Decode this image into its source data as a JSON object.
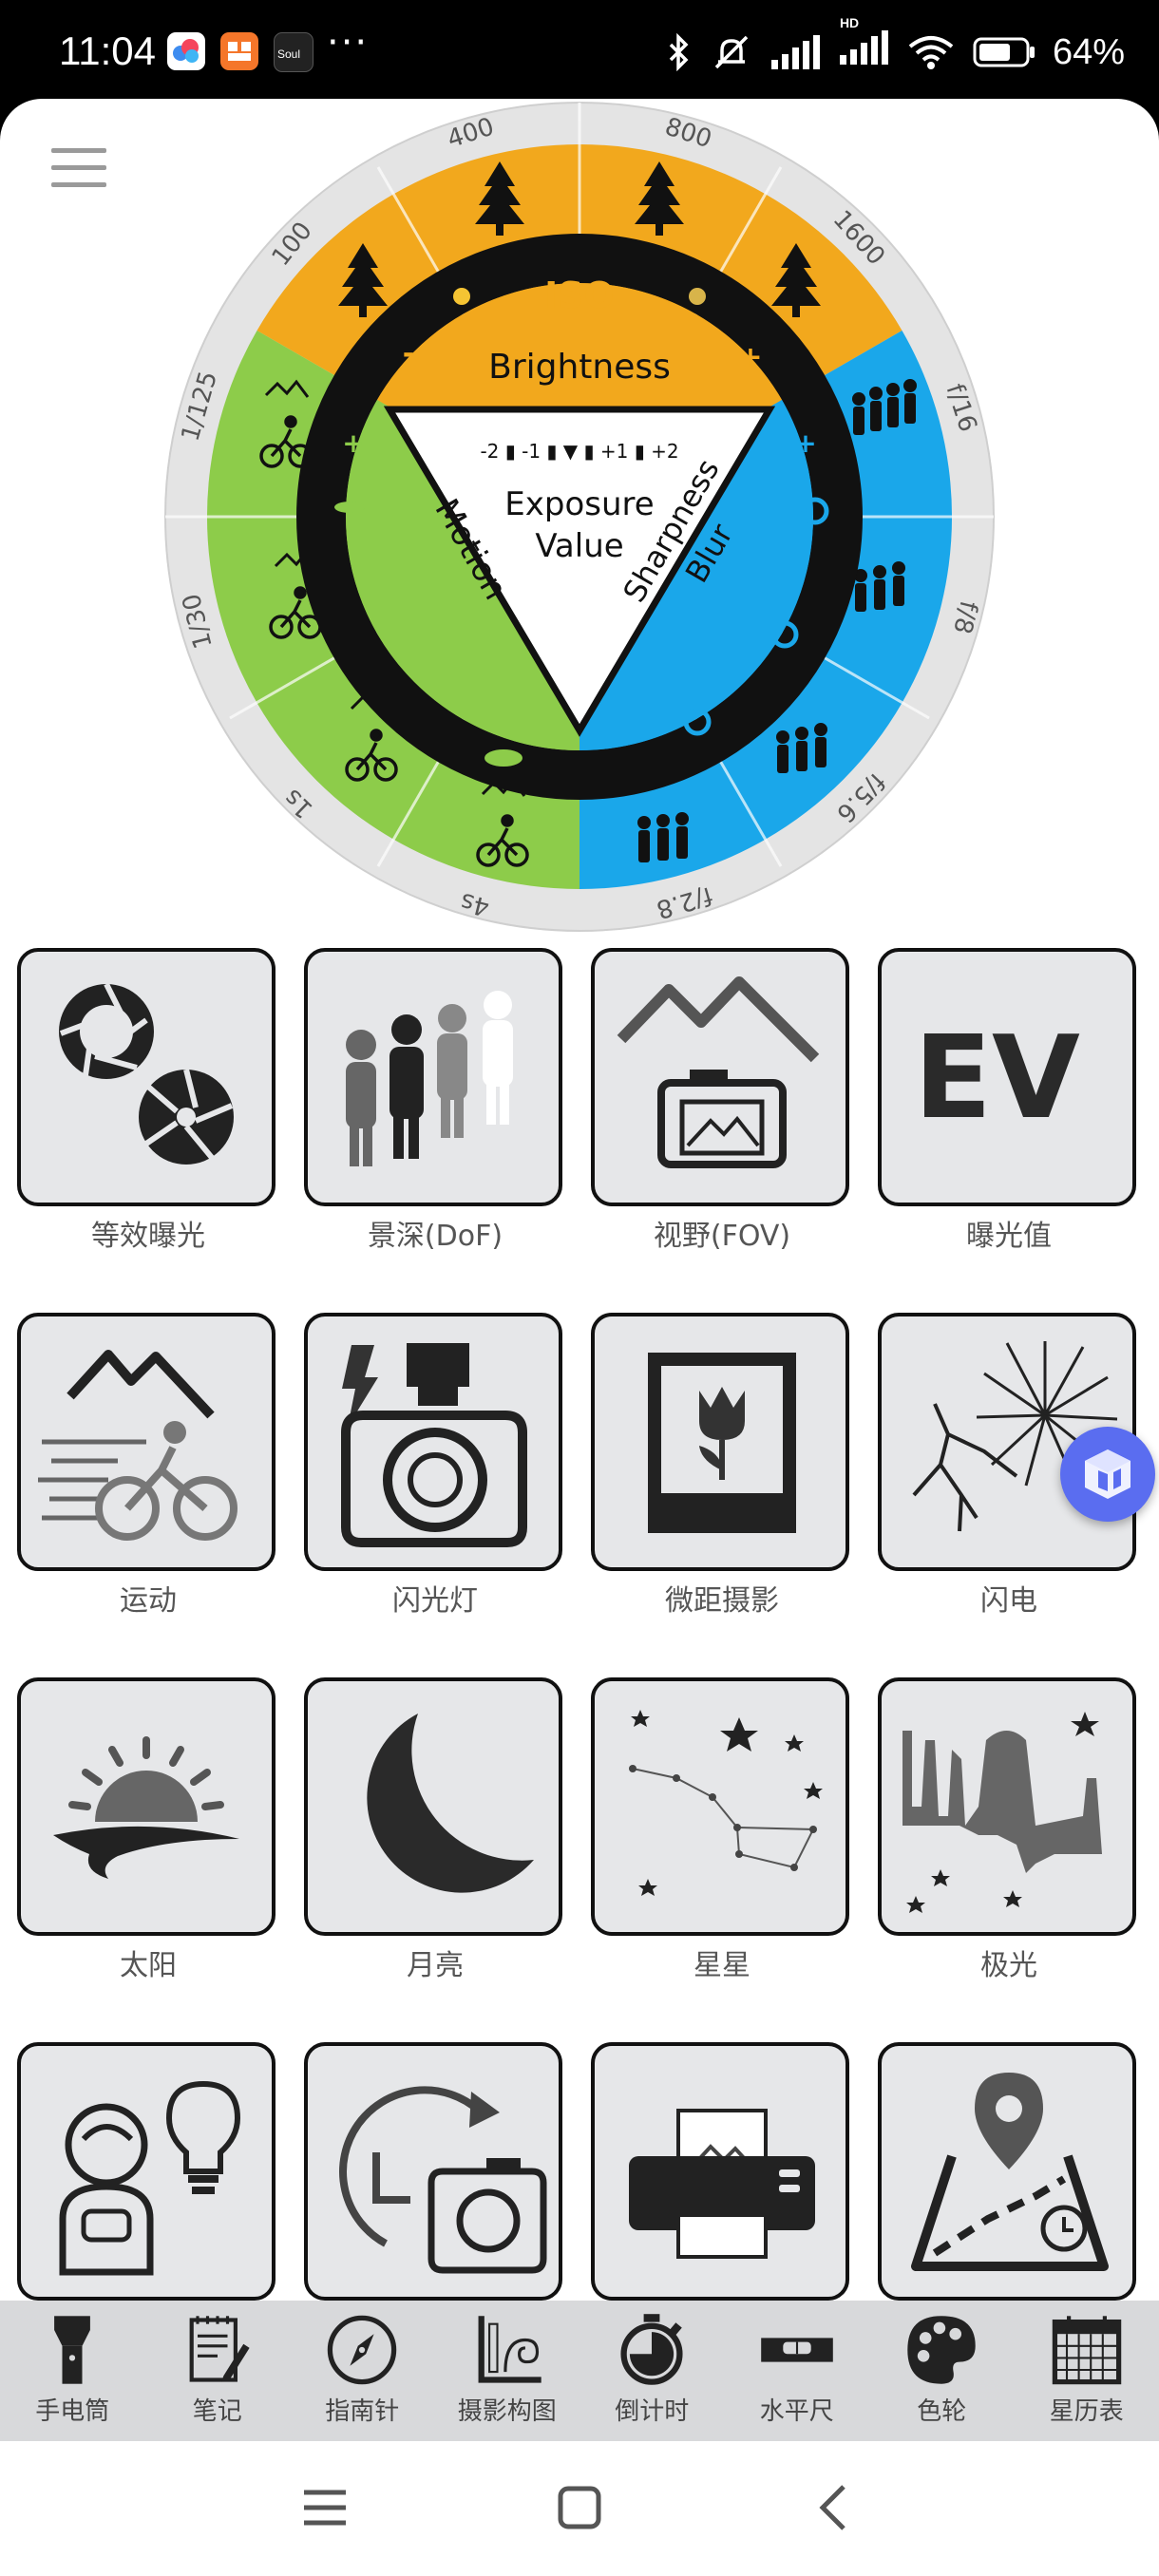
{
  "status_bar": {
    "time": "11:04",
    "dots": "···",
    "battery": "64%",
    "network": "HD"
  },
  "wheel": {
    "iso_label": "ISO",
    "brightness_label": "Brightness",
    "minus": "-",
    "plus": "+",
    "ev_scale": "-2 ▮ -1 ▮ ▼ ▮ +1 ▮ +2",
    "center_line1": "Exposure",
    "center_line2": "Value",
    "motion_label": "Motion",
    "sharpness_line1": "Sharpness",
    "sharpness_line2": "Blur",
    "iso_values": [
      "100",
      "400",
      "800",
      "1600"
    ],
    "aperture_values": [
      "f/16",
      "f/8",
      "f/5.6",
      "f/2.8"
    ],
    "shutter_values": [
      "1/125",
      "1/30",
      "1s",
      "4s"
    ],
    "colors": {
      "iso": "#f2a81d",
      "aperture": "#1aa7ea",
      "motion": "#8dcc4a",
      "ring": "#111111",
      "outer": "#e4e4e4"
    }
  },
  "tiles": [
    {
      "label": "等效曝光",
      "icon": "equivalent-exposure-icon"
    },
    {
      "label": "景深(DoF)",
      "icon": "depth-of-field-icon"
    },
    {
      "label": "视野(FOV)",
      "icon": "field-of-view-icon"
    },
    {
      "label": "曝光值",
      "icon": "ev-icon",
      "text": "EV"
    },
    {
      "label": "运动",
      "icon": "motion-icon"
    },
    {
      "label": "闪光灯",
      "icon": "flash-icon"
    },
    {
      "label": "微距摄影",
      "icon": "macro-icon"
    },
    {
      "label": "闪电",
      "icon": "lightning-icon"
    },
    {
      "label": "太阳",
      "icon": "sun-icon"
    },
    {
      "label": "月亮",
      "icon": "moon-icon"
    },
    {
      "label": "星星",
      "icon": "stars-icon"
    },
    {
      "label": "极光",
      "icon": "aurora-icon"
    },
    {
      "label": "",
      "icon": "astronaut-bulb-icon"
    },
    {
      "label": "",
      "icon": "timelapse-camera-icon"
    },
    {
      "label": "",
      "icon": "printer-icon"
    },
    {
      "label": "",
      "icon": "map-location-icon"
    }
  ],
  "toolbar": [
    {
      "label": "手电筒",
      "icon": "flashlight-icon"
    },
    {
      "label": "笔记",
      "icon": "notepad-icon"
    },
    {
      "label": "指南针",
      "icon": "compass-icon"
    },
    {
      "label": "摄影构图",
      "icon": "composition-icon"
    },
    {
      "label": "倒计时",
      "icon": "stopwatch-icon"
    },
    {
      "label": "水平尺",
      "icon": "level-icon"
    },
    {
      "label": "色轮",
      "icon": "palette-icon"
    },
    {
      "label": "星历表",
      "icon": "calendar-icon"
    }
  ]
}
